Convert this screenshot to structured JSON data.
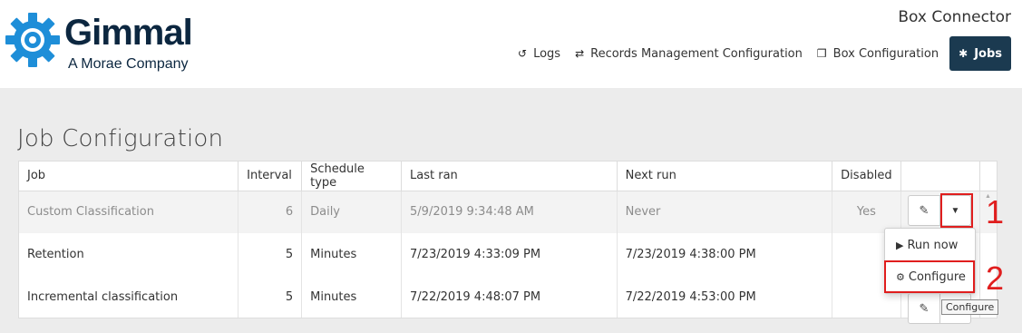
{
  "brand": {
    "name": "Gimmal",
    "tagline": "A Morae Company",
    "color": "#0c2740",
    "gear_color": "#1e8ed8"
  },
  "app_title": "Box Connector",
  "nav": {
    "items": [
      {
        "label": "Logs",
        "icon": "history-icon",
        "glyph": "↺"
      },
      {
        "label": "Records Management Configuration",
        "icon": "exchange-icon",
        "glyph": "⇄"
      },
      {
        "label": "Box Configuration",
        "icon": "cube-icon",
        "glyph": "❒"
      },
      {
        "label": "Jobs",
        "icon": "gear-icon",
        "glyph": "✱"
      }
    ],
    "active_color": "#1b3a50"
  },
  "page_title": "Job Configuration",
  "table": {
    "headers": [
      "Job",
      "Interval",
      "Schedule type",
      "Last ran",
      "Next run",
      "Disabled",
      ""
    ],
    "rows": [
      {
        "job": "Custom Classification",
        "interval": "6",
        "schedule": "Daily",
        "last_ran": "5/9/2019 9:34:48 AM",
        "next_run": "Never",
        "disabled": "Yes"
      },
      {
        "job": "Retention",
        "interval": "5",
        "schedule": "Minutes",
        "last_ran": "7/23/2019 4:33:09 PM",
        "next_run": "7/23/2019 4:38:00 PM",
        "disabled": ""
      },
      {
        "job": "Incremental classification",
        "interval": "5",
        "schedule": "Minutes",
        "last_ran": "7/22/2019 4:48:07 PM",
        "next_run": "7/22/2019 4:53:00 PM",
        "disabled": ""
      }
    ]
  },
  "dropdown": {
    "items": [
      {
        "label": "Run now",
        "icon": "play-icon",
        "glyph": "▶"
      },
      {
        "label": "Configure",
        "icon": "cog-icon",
        "glyph": "⚙"
      }
    ]
  },
  "tooltip": "Configure",
  "annotations": {
    "step1": "1",
    "step2": "2",
    "color": "#e01e1e"
  }
}
